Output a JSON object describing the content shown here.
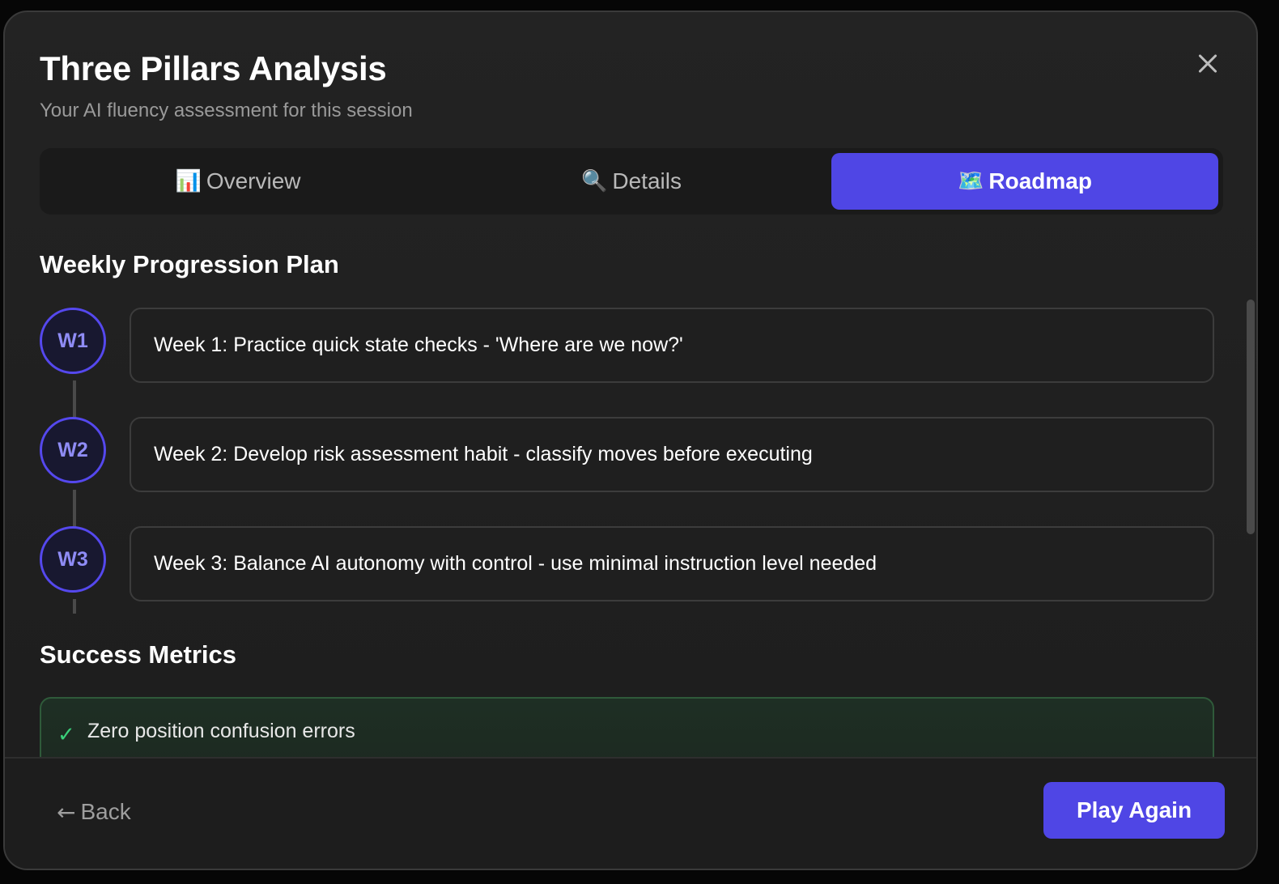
{
  "header": {
    "title": "Three Pillars Analysis",
    "subtitle": "Your AI fluency assessment for this session",
    "close_icon": "close-icon"
  },
  "tabs": [
    {
      "icon": "📊",
      "icon_name": "bar-chart-icon",
      "label": "Overview",
      "active": false
    },
    {
      "icon": "🔍",
      "icon_name": "magnifier-icon",
      "label": "Details",
      "active": false
    },
    {
      "icon": "🗺️",
      "icon_name": "map-icon",
      "label": "Roadmap",
      "active": true
    }
  ],
  "roadmap": {
    "plan_title": "Weekly Progression Plan",
    "weeks": [
      {
        "badge": "W1",
        "text": "Week 1: Practice quick state checks - 'Where are we now?'"
      },
      {
        "badge": "W2",
        "text": "Week 2: Develop risk assessment habit - classify moves before executing"
      },
      {
        "badge": "W3",
        "text": "Week 3: Balance AI autonomy with control - use minimal instruction level needed"
      }
    ],
    "metrics_title": "Success Metrics",
    "metrics": [
      {
        "check": "✓",
        "text": "Zero position confusion errors"
      }
    ]
  },
  "footer": {
    "back_arrow": "←",
    "back_label": "Back",
    "play_label": "Play Again"
  },
  "colors": {
    "accent": "#4f46e5",
    "badge_text": "#8f8cf5",
    "success": "#3ad07a",
    "background": "#1f1f1f"
  }
}
